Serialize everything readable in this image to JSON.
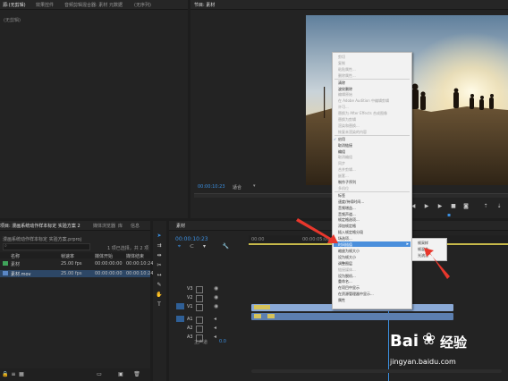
{
  "source_panel": {
    "tabs": [
      "源:(无剪辑)",
      "效果控件",
      "音频剪辑混合器: 素材",
      "元数据",
      "(无序列)"
    ],
    "label": "(无剪辑)"
  },
  "program_monitor": {
    "title": "节目: 素材",
    "timecode": "00:00:10:23",
    "fit_label": "适合"
  },
  "project_panel": {
    "title": "项目: 漫画系统动作样本标定 实验方案 2",
    "file": "漫画系统动作样本标定 实验方案.prproj",
    "tabs": [
      "媒体浏览器",
      "库",
      "信息"
    ],
    "item_count": "1 项已选择，共 2 项",
    "columns": [
      "名称",
      "帧速率",
      "媒体开始",
      "媒体结束"
    ],
    "rows": [
      {
        "name": "素材",
        "rate": "25.00 fps",
        "start": "00:00:00:00",
        "end": "00:00:10:24"
      },
      {
        "name": "素材.mov",
        "rate": "25.00 fps",
        "start": "00:00:00:00",
        "end": "00:00:10:24"
      }
    ]
  },
  "timeline": {
    "title": "素材",
    "timecode": "00:00:10:23",
    "ruler_start": "00:00",
    "ruler_mid": "00:00:05:00",
    "tracks": [
      "V3",
      "V2",
      "V1",
      "A1",
      "A2",
      "A3"
    ],
    "master_label": "主声道",
    "master_value": "0.0"
  },
  "context_menu": {
    "items": [
      {
        "label": "剪切",
        "disabled": true
      },
      {
        "label": "复制",
        "disabled": true
      },
      {
        "label": "粘贴属性...",
        "disabled": true
      },
      {
        "label": "删除属性...",
        "disabled": true
      },
      {
        "label": "清除",
        "disabled": false
      },
      {
        "label": "波纹删除",
        "disabled": false
      },
      {
        "label": "编辑原始",
        "disabled": true
      },
      {
        "label": "在 Adobe Audition 中编辑剪辑",
        "disabled": true
      },
      {
        "label": "许可...",
        "disabled": true
      },
      {
        "label": "替换为 After Effects 合成图像",
        "disabled": true
      },
      {
        "label": "替换为剪辑",
        "disabled": true
      },
      {
        "label": "渲染和替换...",
        "disabled": true
      },
      {
        "label": "恢复未渲染的内容",
        "disabled": true
      },
      {
        "label": "启用",
        "disabled": false,
        "checked": true
      },
      {
        "label": "取消链接",
        "disabled": false
      },
      {
        "label": "编组",
        "disabled": false
      },
      {
        "label": "取消编组",
        "disabled": true
      },
      {
        "label": "同步",
        "disabled": true
      },
      {
        "label": "合并剪辑...",
        "disabled": true
      },
      {
        "label": "嵌套...",
        "disabled": true
      },
      {
        "label": "制作子序列",
        "disabled": false
      },
      {
        "label": "多机位",
        "disabled": true
      },
      {
        "label": "标签",
        "disabled": false
      },
      {
        "label": "速度/持续时间...",
        "disabled": false
      },
      {
        "label": "音频增益...",
        "disabled": false
      },
      {
        "label": "音频声道...",
        "disabled": false
      },
      {
        "label": "帧定格选项...",
        "disabled": false
      },
      {
        "label": "添加帧定格",
        "disabled": false
      },
      {
        "label": "插入帧定格分段",
        "disabled": false
      },
      {
        "label": "场选项...",
        "disabled": false
      },
      {
        "label": "时间插值",
        "disabled": false,
        "highlighted": true
      },
      {
        "label": "缩放为帧大小",
        "disabled": false
      },
      {
        "label": "设为帧大小",
        "disabled": false
      },
      {
        "label": "调整图层",
        "disabled": false
      },
      {
        "label": "链接媒体...",
        "disabled": true
      },
      {
        "label": "设为脱机...",
        "disabled": false
      },
      {
        "label": "重命名...",
        "disabled": false
      },
      {
        "label": "在项目中显示",
        "disabled": false
      },
      {
        "label": "在资源管理器中显示...",
        "disabled": false
      },
      {
        "label": "属性",
        "disabled": false
      }
    ],
    "submenu": [
      "帧采样",
      "帧混合",
      "光流法"
    ]
  },
  "watermark": {
    "brand": "Bai",
    "brand2": "经验",
    "url": "jingyan.baidu.com"
  },
  "colors": {
    "accent": "#4a8fdc",
    "arrow": "#e8372c",
    "timecode": "#3b8fe0",
    "clip_video": "#8aa9d6",
    "clip_label": "#d6c35a"
  }
}
